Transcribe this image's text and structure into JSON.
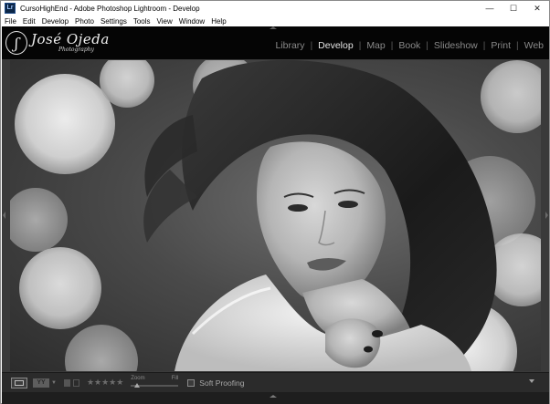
{
  "window": {
    "title": "CursoHighEnd - Adobe Photoshop Lightroom - Develop",
    "app_icon_text": "Lr"
  },
  "menu": [
    "File",
    "Edit",
    "Develop",
    "Photo",
    "Settings",
    "Tools",
    "View",
    "Window",
    "Help"
  ],
  "identity_plate": {
    "name": "José Ojeda",
    "subtitle": "Photography",
    "mark": "JO"
  },
  "modules": [
    {
      "label": "Library",
      "active": false
    },
    {
      "label": "Develop",
      "active": true
    },
    {
      "label": "Map",
      "active": false
    },
    {
      "label": "Book",
      "active": false
    },
    {
      "label": "Slideshow",
      "active": false
    },
    {
      "label": "Print",
      "active": false
    },
    {
      "label": "Web",
      "active": false
    }
  ],
  "toolbar": {
    "compare_label": "YY",
    "stars": "★★★★★",
    "zoom_label": "Zoom",
    "fill_label": "Fill",
    "soft_proofing_label": "Soft Proofing"
  },
  "icons": {
    "loupe_view": "loupe-view-icon",
    "compare_view": "before-after-icon",
    "toolbar_menu": "chevron-down-icon"
  },
  "colors": {
    "panel_bg": "#050505",
    "workspace_bg": "#3a3a3a",
    "toolbar_bg": "#2b2b2b",
    "active_module": "#e6e6e6",
    "inactive_module": "#8a8a8a"
  }
}
